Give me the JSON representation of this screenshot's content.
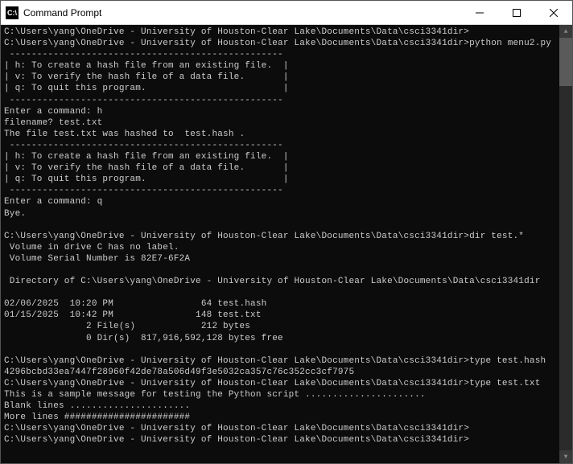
{
  "window": {
    "title": "Command Prompt",
    "icon_label": "C:\\"
  },
  "terminal": {
    "lines": [
      "C:\\Users\\yang\\OneDrive - University of Houston-Clear Lake\\Documents\\Data\\csci3341dir>",
      "C:\\Users\\yang\\OneDrive - University of Houston-Clear Lake\\Documents\\Data\\csci3341dir>python menu2.py",
      " --------------------------------------------------",
      "| h: To create a hash file from an existing file.  |",
      "| v: To verify the hash file of a data file.       |",
      "| q: To quit this program.                         |",
      " --------------------------------------------------",
      "Enter a command: h",
      "filename? test.txt",
      "The file test.txt was hashed to  test.hash .",
      " --------------------------------------------------",
      "| h: To create a hash file from an existing file.  |",
      "| v: To verify the hash file of a data file.       |",
      "| q: To quit this program.                         |",
      " --------------------------------------------------",
      "Enter a command: q",
      "Bye.",
      "",
      "C:\\Users\\yang\\OneDrive - University of Houston-Clear Lake\\Documents\\Data\\csci3341dir>dir test.*",
      " Volume in drive C has no label.",
      " Volume Serial Number is 82E7-6F2A",
      "",
      " Directory of C:\\Users\\yang\\OneDrive - University of Houston-Clear Lake\\Documents\\Data\\csci3341dir",
      "",
      "02/06/2025  10:20 PM                64 test.hash",
      "01/15/2025  10:42 PM               148 test.txt",
      "               2 File(s)            212 bytes",
      "               0 Dir(s)  817,916,592,128 bytes free",
      "",
      "C:\\Users\\yang\\OneDrive - University of Houston-Clear Lake\\Documents\\Data\\csci3341dir>type test.hash",
      "4296bcbd33ea7447f28960f42de78a506d49f3e5032ca357c76c352cc3cf7975",
      "C:\\Users\\yang\\OneDrive - University of Houston-Clear Lake\\Documents\\Data\\csci3341dir>type test.txt",
      "This is a sample message for testing the Python script ......................",
      "Blank lines ......................",
      "More lines #######################",
      "C:\\Users\\yang\\OneDrive - University of Houston-Clear Lake\\Documents\\Data\\csci3341dir>",
      "C:\\Users\\yang\\OneDrive - University of Houston-Clear Lake\\Documents\\Data\\csci3341dir>"
    ]
  }
}
